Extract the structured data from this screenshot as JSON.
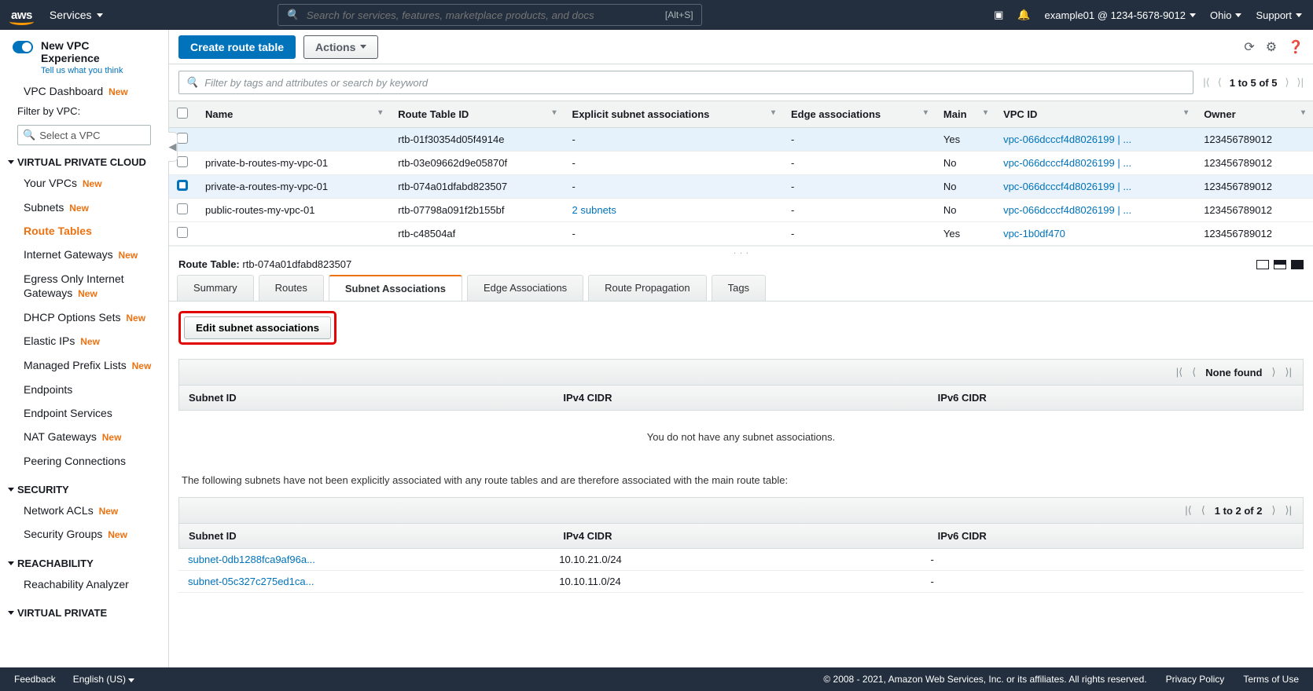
{
  "topnav": {
    "services": "Services",
    "search_placeholder": "Search for services, features, marketplace products, and docs",
    "search_shortcut": "[Alt+S]",
    "account": "example01 @ 1234-5678-9012",
    "region": "Ohio",
    "support": "Support"
  },
  "sidebar": {
    "new_experience_title": "New VPC Experience",
    "new_experience_sub": "Tell us what you think",
    "vpc_dashboard": "VPC Dashboard",
    "filter_label": "Filter by VPC:",
    "vpc_select_placeholder": "Select a VPC",
    "groups": [
      {
        "title": "VIRTUAL PRIVATE CLOUD",
        "items": [
          {
            "label": "Your VPCs",
            "new": true
          },
          {
            "label": "Subnets",
            "new": true
          },
          {
            "label": "Route Tables",
            "active": true
          },
          {
            "label": "Internet Gateways",
            "new": true
          },
          {
            "label": "Egress Only Internet Gateways",
            "new": true
          },
          {
            "label": "DHCP Options Sets",
            "new": true
          },
          {
            "label": "Elastic IPs",
            "new": true
          },
          {
            "label": "Managed Prefix Lists",
            "new": true
          },
          {
            "label": "Endpoints"
          },
          {
            "label": "Endpoint Services"
          },
          {
            "label": "NAT Gateways",
            "new": true
          },
          {
            "label": "Peering Connections"
          }
        ]
      },
      {
        "title": "SECURITY",
        "items": [
          {
            "label": "Network ACLs",
            "new": true
          },
          {
            "label": "Security Groups",
            "new": true
          }
        ]
      },
      {
        "title": "REACHABILITY",
        "items": [
          {
            "label": "Reachability Analyzer"
          }
        ]
      },
      {
        "title": "VIRTUAL PRIVATE",
        "items": []
      }
    ]
  },
  "actionbar": {
    "create": "Create route table",
    "actions": "Actions"
  },
  "filter": {
    "placeholder": "Filter by tags and attributes or search by keyword",
    "pager": "1 to 5 of 5"
  },
  "grid": {
    "columns": [
      "Name",
      "Route Table ID",
      "Explicit subnet associations",
      "Edge associations",
      "Main",
      "VPC ID",
      "Owner"
    ],
    "rows": [
      {
        "selected": false,
        "highlight": true,
        "name": "",
        "rtid": "rtb-01f30354d05f4914e",
        "esa": "-",
        "edge": "-",
        "main": "Yes",
        "vpc": "vpc-066dcccf4d8026199 | ...",
        "owner": "123456789012"
      },
      {
        "selected": false,
        "name": "private-b-routes-my-vpc-01",
        "rtid": "rtb-03e09662d9e05870f",
        "esa": "-",
        "edge": "-",
        "main": "No",
        "vpc": "vpc-066dcccf4d8026199 | ...",
        "owner": "123456789012"
      },
      {
        "selected": true,
        "highlight": true,
        "name": "private-a-routes-my-vpc-01",
        "rtid": "rtb-074a01dfabd823507",
        "esa": "-",
        "edge": "-",
        "main": "No",
        "vpc": "vpc-066dcccf4d8026199 | ...",
        "owner": "123456789012"
      },
      {
        "selected": false,
        "name": "public-routes-my-vpc-01",
        "rtid": "rtb-07798a091f2b155bf",
        "esa_link": "2 subnets",
        "edge": "-",
        "main": "No",
        "vpc": "vpc-066dcccf4d8026199 | ...",
        "owner": "123456789012"
      },
      {
        "selected": false,
        "name": "",
        "rtid": "rtb-c48504af",
        "esa": "-",
        "edge": "-",
        "main": "Yes",
        "vpc": "vpc-1b0df470",
        "owner": "123456789012"
      }
    ]
  },
  "details": {
    "label": "Route Table:",
    "id": "rtb-074a01dfabd823507",
    "tabs": [
      "Summary",
      "Routes",
      "Subnet Associations",
      "Edge Associations",
      "Route Propagation",
      "Tags"
    ],
    "active_tab": "Subnet Associations",
    "edit_btn": "Edit subnet associations",
    "pager1": "None found",
    "sub_cols": [
      "Subnet ID",
      "IPv4 CIDR",
      "IPv6 CIDR"
    ],
    "empty_msg": "You do not have any subnet associations.",
    "note": "The following subnets have not been explicitly associated with any route tables and are therefore associated with the main route table:",
    "pager2": "1 to 2 of 2",
    "implicit_rows": [
      {
        "subnet": "subnet-0db1288fca9af96a...",
        "v4": "10.10.21.0/24",
        "v6": "-"
      },
      {
        "subnet": "subnet-05c327c275ed1ca...",
        "v4": "10.10.11.0/24",
        "v6": "-"
      }
    ]
  },
  "footer": {
    "feedback": "Feedback",
    "lang": "English (US)",
    "copyright": "© 2008 - 2021, Amazon Web Services, Inc. or its affiliates. All rights reserved.",
    "privacy": "Privacy Policy",
    "terms": "Terms of Use"
  }
}
